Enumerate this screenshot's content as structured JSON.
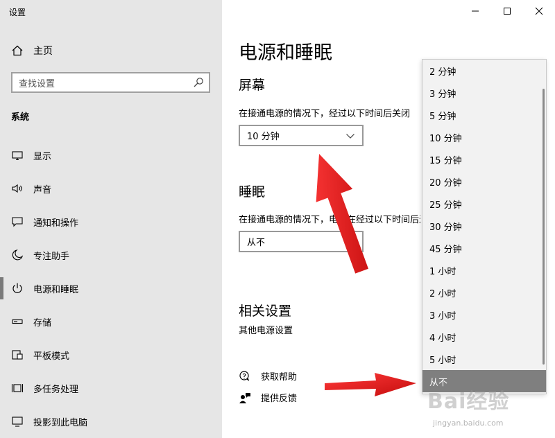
{
  "app": {
    "title": "设置"
  },
  "sidebar": {
    "home_label": "主页",
    "search_placeholder": "查找设置",
    "section": "系统",
    "items": [
      {
        "label": "显示",
        "icon": "monitor-icon"
      },
      {
        "label": "声音",
        "icon": "speaker-icon"
      },
      {
        "label": "通知和操作",
        "icon": "notification-icon"
      },
      {
        "label": "专注助手",
        "icon": "moon-icon"
      },
      {
        "label": "电源和睡眠",
        "icon": "power-icon",
        "active": true
      },
      {
        "label": "存储",
        "icon": "storage-icon"
      },
      {
        "label": "平板模式",
        "icon": "tablet-icon"
      },
      {
        "label": "多任务处理",
        "icon": "multitask-icon"
      },
      {
        "label": "投影到此电脑",
        "icon": "project-icon"
      }
    ]
  },
  "main": {
    "title": "电源和睡眠",
    "screen": {
      "heading": "屏幕",
      "description": "在接通电源的情况下，经过以下时间后关闭",
      "value": "10 分钟"
    },
    "sleep": {
      "heading": "睡眠",
      "description": "在接通电源的情况下，电脑在经过以下时间后进入睡眠状态",
      "value": "从不"
    },
    "related": {
      "heading": "相关设置",
      "link": "其他电源设置"
    },
    "help": {
      "get_help": "获取帮助",
      "feedback": "提供反馈"
    }
  },
  "dropdown": {
    "options": [
      "2 分钟",
      "3 分钟",
      "5 分钟",
      "10 分钟",
      "15 分钟",
      "20 分钟",
      "25 分钟",
      "30 分钟",
      "45 分钟",
      "1 小时",
      "2 小时",
      "3 小时",
      "4 小时",
      "5 小时",
      "从不"
    ],
    "selected": "从不"
  },
  "watermark": {
    "logo": "Bai经验",
    "url": "jingyan.baidu.com"
  },
  "colors": {
    "sidebar_bg": "#e6e6e6",
    "arrow": "#e11b1b",
    "selected_bg": "#7f7f7f"
  }
}
